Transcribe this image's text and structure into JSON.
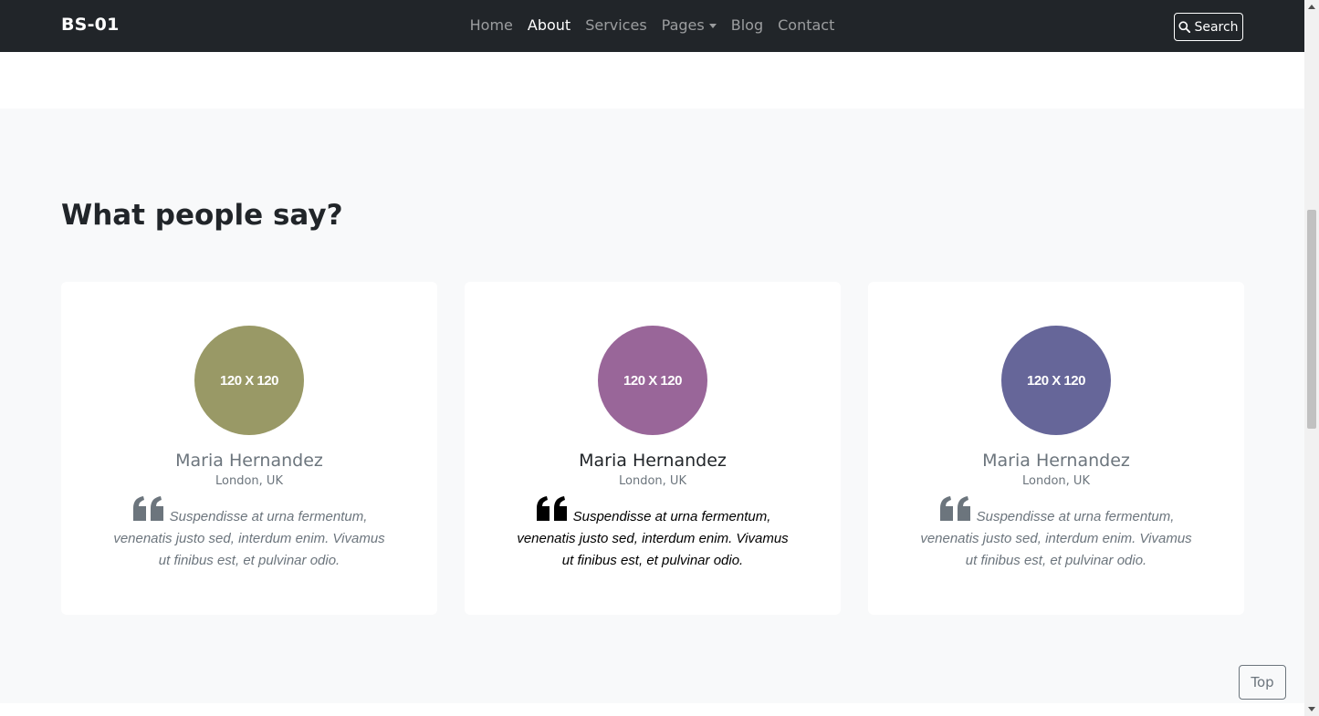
{
  "navbar": {
    "brand": "BS-01",
    "links": [
      "Home",
      "About",
      "Services",
      "Pages",
      "Blog",
      "Contact"
    ],
    "active": "About",
    "search_label": "Search"
  },
  "testimonials": {
    "heading": "What people say?",
    "cards": [
      {
        "avatar_text": "120 X 120",
        "avatar_color": "#999966",
        "name": "Maria Hernandez",
        "location": "London, UK",
        "quote": "Suspendisse at urna fermentum, venenatis justo sed, interdum enim. Vivamus ut finibus est, et pulvinar odio."
      },
      {
        "avatar_text": "120 X 120",
        "avatar_color": "#996699",
        "name": "Maria Hernandez",
        "location": "London, UK",
        "quote": "Suspendisse at urna fermentum, venenatis justo sed, interdum enim. Vivamus ut finibus est, et pulvinar odio."
      },
      {
        "avatar_text": "120 X 120",
        "avatar_color": "#666699",
        "name": "Maria Hernandez",
        "location": "London, UK",
        "quote": "Suspendisse at urna fermentum, venenatis justo sed, interdum enim. Vivamus ut finibus est, et pulvinar odio."
      }
    ]
  },
  "top_button_label": "Top",
  "icons": {
    "search": "search-icon",
    "quote": "quote-left-icon",
    "dropdown": "caret-down-icon"
  }
}
